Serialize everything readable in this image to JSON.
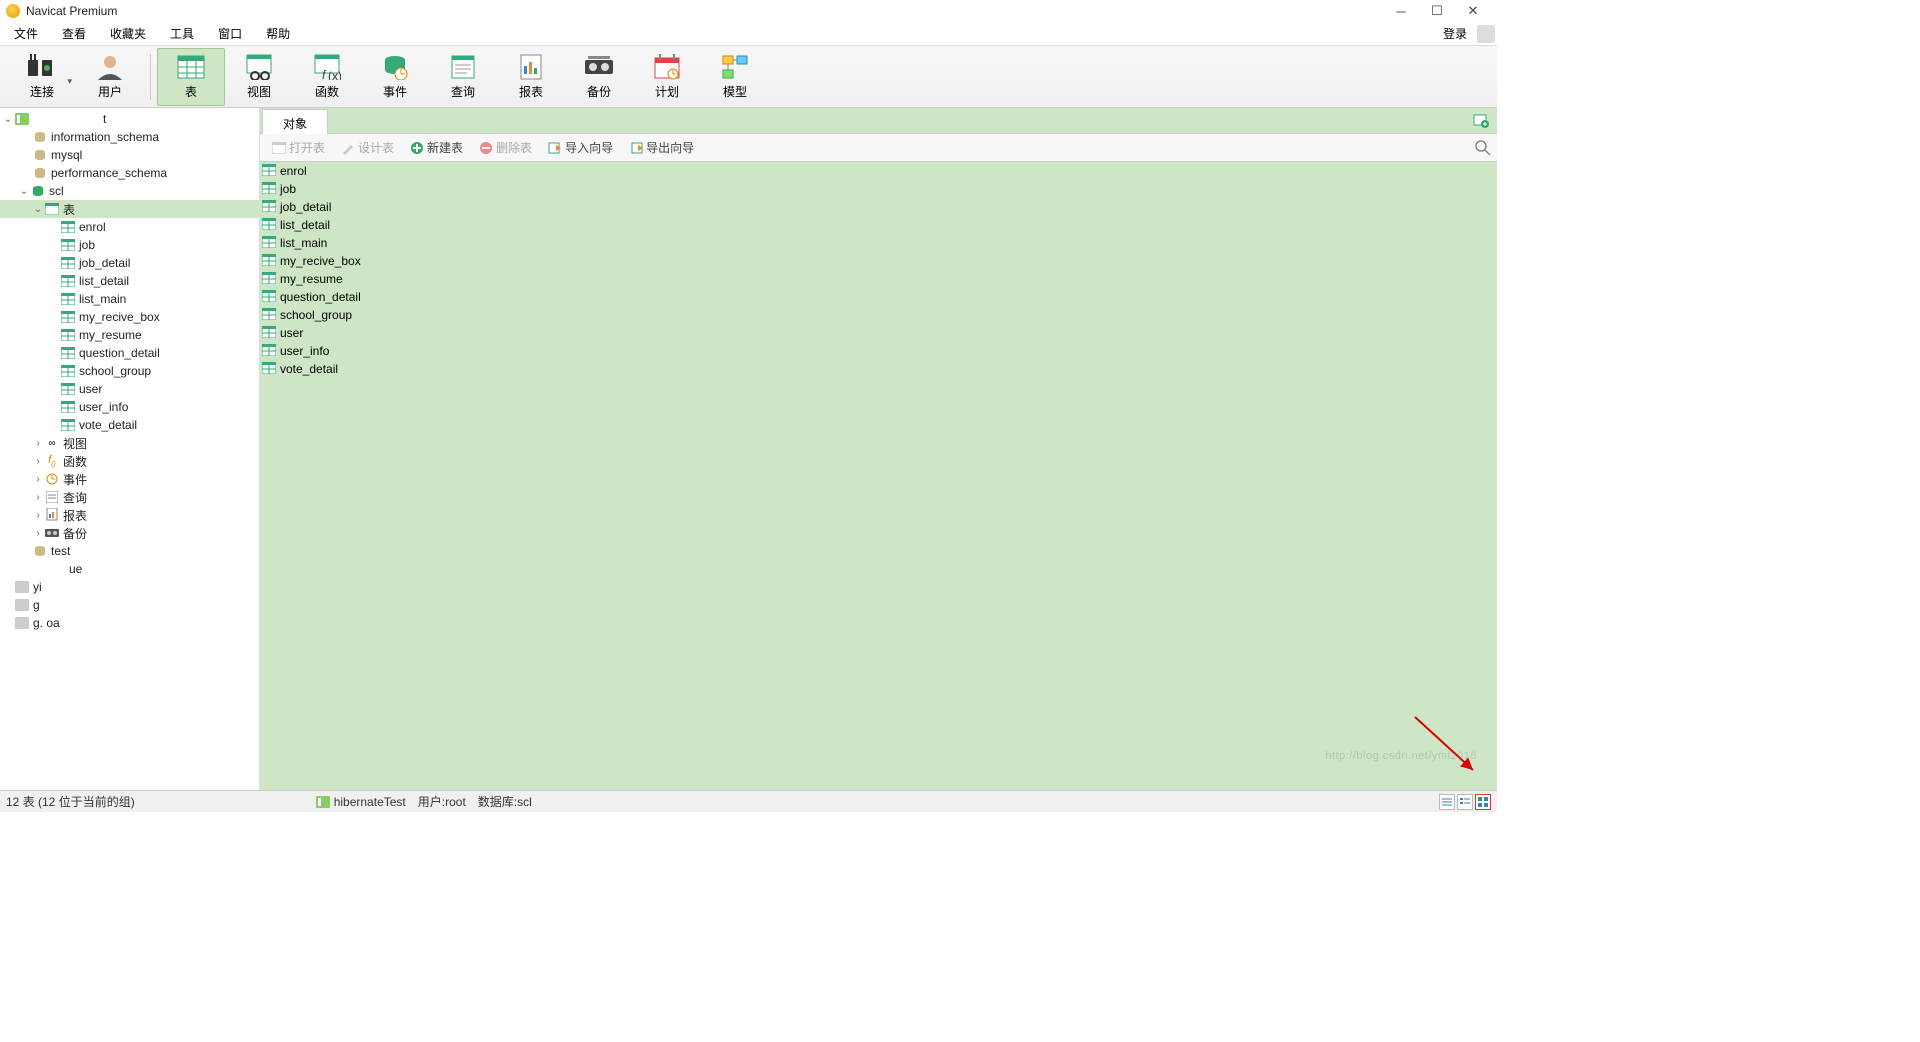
{
  "title": "Navicat Premium",
  "menu": {
    "file": "文件",
    "view": "查看",
    "fav": "收藏夹",
    "tools": "工具",
    "window": "窗口",
    "help": "帮助",
    "login": "登录"
  },
  "toolbar": {
    "connect": "连接",
    "user": "用户",
    "table": "表",
    "viewobj": "视图",
    "func": "函数",
    "event": "事件",
    "query": "查询",
    "report": "报表",
    "backup": "备份",
    "plan": "计划",
    "model": "模型"
  },
  "sidebar": {
    "conn_masked": "t",
    "dbs": {
      "info_schema": "information_schema",
      "mysql": "mysql",
      "perf": "performance_schema",
      "scl": "scl",
      "test": "test"
    },
    "folders": {
      "table": "表",
      "view": "视图",
      "func": "函数",
      "event": "事件",
      "query": "查询",
      "report": "报表",
      "backup": "备份"
    },
    "tables": [
      "enrol",
      "job",
      "job_detail",
      "list_detail",
      "list_main",
      "my_recive_box",
      "my_resume",
      "question_detail",
      "school_group",
      "user",
      "user_info",
      "vote_detail"
    ],
    "partials": {
      "a": "ue",
      "b": "yi",
      "c": "g",
      "d": "g.    oa"
    }
  },
  "tabbar": {
    "obj": "对象"
  },
  "objbar": {
    "open": "打开表",
    "design": "设计表",
    "new": "新建表",
    "del": "删除表",
    "import": "导入向导",
    "export": "导出向导"
  },
  "list": [
    "enrol",
    "job",
    "job_detail",
    "list_detail",
    "list_main",
    "my_recive_box",
    "my_resume",
    "question_detail",
    "school_group",
    "user",
    "user_info",
    "vote_detail"
  ],
  "status": {
    "left": "12 表 (12 位于当前的组)",
    "conn": "hibernateTest",
    "user_l": "用户: ",
    "user_v": "root",
    "db_l": "数据库: ",
    "db_v": "scl"
  },
  "watermark": "http://blog.csdn.net/yml2016"
}
